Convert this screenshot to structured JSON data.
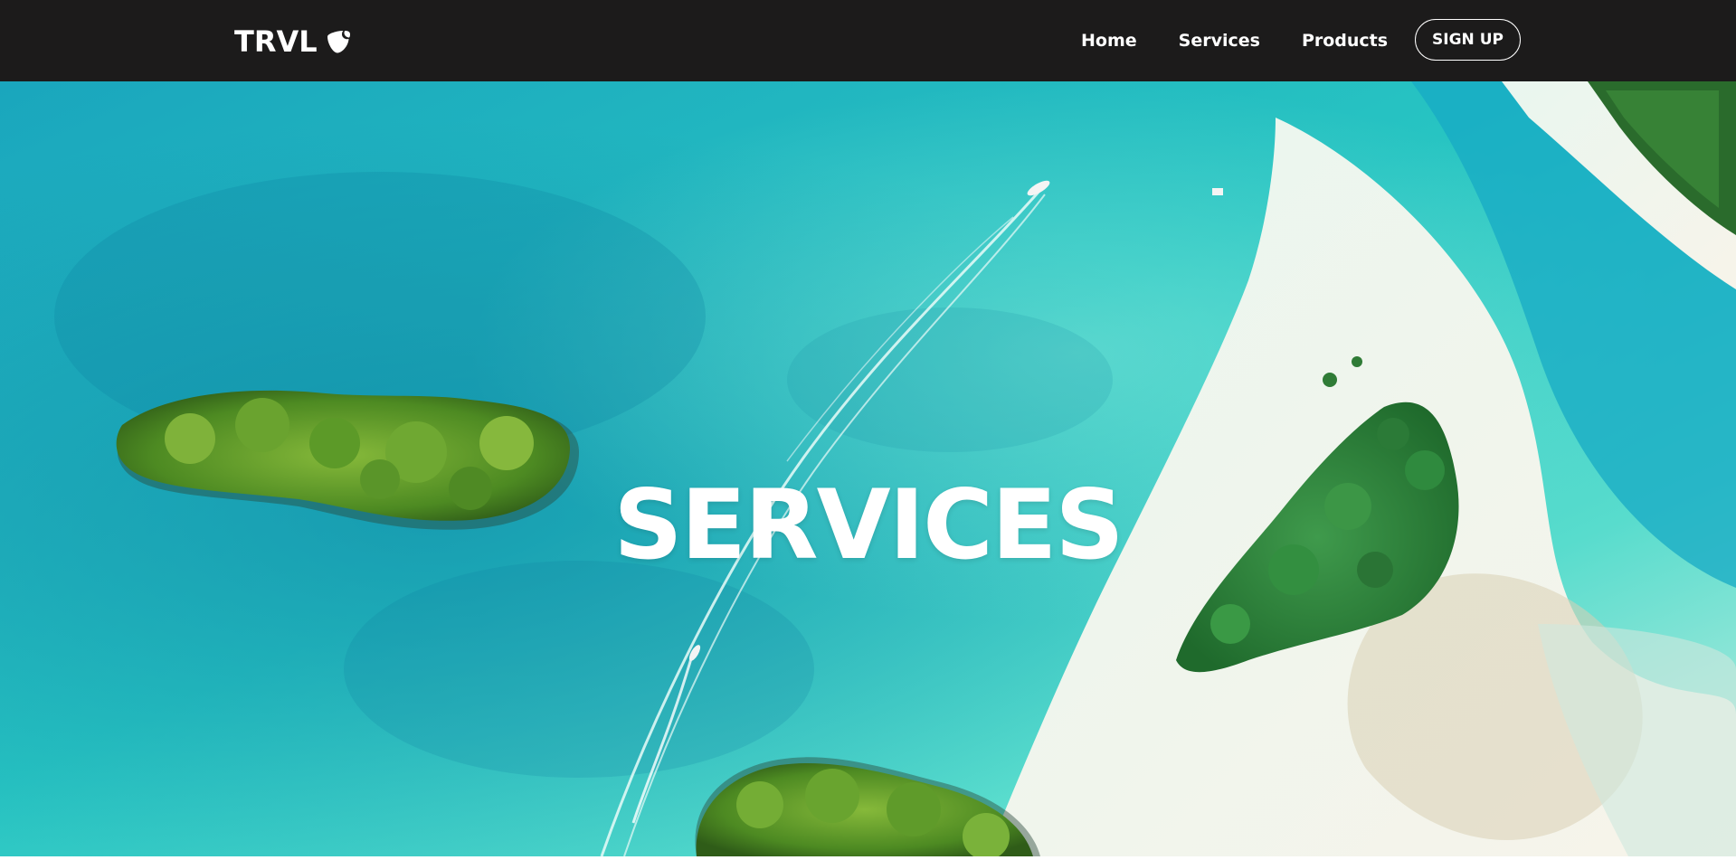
{
  "brand": {
    "name": "TRVL",
    "icon": "typo3-logo-icon"
  },
  "nav": {
    "links": [
      {
        "label": "Home"
      },
      {
        "label": "Services"
      },
      {
        "label": "Products"
      }
    ],
    "signup_label": "SIGN UP"
  },
  "hero": {
    "title": "SERVICES",
    "background": "aerial-ocean-islands-photo"
  },
  "colors": {
    "navbar_bg": "#1c1b1b",
    "text": "#ffffff",
    "water_deep": "#0f93b4",
    "water_light": "#3fd3c8",
    "sand": "#f2f1ea",
    "island_green": "#5d9a2c"
  }
}
